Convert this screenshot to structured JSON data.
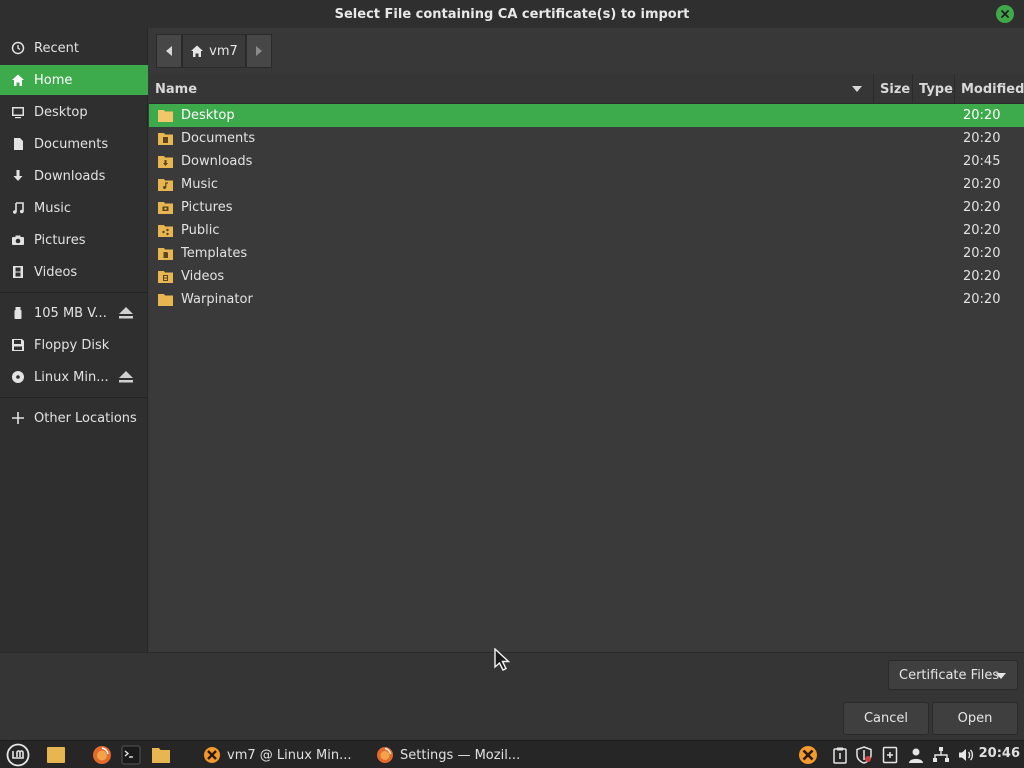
{
  "window": {
    "title": "Select File containing CA certificate(s) to import"
  },
  "sidebar": {
    "items": [
      {
        "label": "Recent",
        "icon": "clock-icon"
      },
      {
        "label": "Home",
        "icon": "home-icon",
        "active": true
      },
      {
        "label": "Desktop",
        "icon": "desktop-icon"
      },
      {
        "label": "Documents",
        "icon": "document-icon"
      },
      {
        "label": "Downloads",
        "icon": "download-icon"
      },
      {
        "label": "Music",
        "icon": "music-icon"
      },
      {
        "label": "Pictures",
        "icon": "camera-icon"
      },
      {
        "label": "Videos",
        "icon": "film-icon"
      }
    ],
    "devices": [
      {
        "label": "105 MB V...",
        "icon": "usb-drive-icon",
        "ejectable": true
      },
      {
        "label": "Floppy Disk",
        "icon": "floppy-icon",
        "ejectable": false
      },
      {
        "label": "Linux Min...",
        "icon": "optical-disc-icon",
        "ejectable": true
      }
    ],
    "other": {
      "label": "Other Locations",
      "icon": "plus-icon"
    }
  },
  "pathbar": {
    "current": "vm7"
  },
  "filelist": {
    "columns": {
      "name": "Name",
      "size": "Size",
      "type": "Type",
      "modified": "Modified"
    },
    "rows": [
      {
        "name": "Desktop",
        "modified": "20:20",
        "icon": "folder-icon",
        "selected": true
      },
      {
        "name": "Documents",
        "modified": "20:20",
        "icon": "folder-documents-icon"
      },
      {
        "name": "Downloads",
        "modified": "20:45",
        "icon": "folder-download-icon"
      },
      {
        "name": "Music",
        "modified": "20:20",
        "icon": "folder-music-icon"
      },
      {
        "name": "Pictures",
        "modified": "20:20",
        "icon": "folder-pictures-icon"
      },
      {
        "name": "Public",
        "modified": "20:20",
        "icon": "folder-public-icon"
      },
      {
        "name": "Templates",
        "modified": "20:20",
        "icon": "folder-templates-icon"
      },
      {
        "name": "Videos",
        "modified": "20:20",
        "icon": "folder-videos-icon"
      },
      {
        "name": "Warpinator",
        "modified": "20:20",
        "icon": "folder-icon"
      }
    ]
  },
  "footer": {
    "filter": "Certificate Files",
    "cancel": "Cancel",
    "open": "Open"
  },
  "taskbar": {
    "windows": [
      {
        "label": "vm7 @ Linux Min...",
        "icon": "xserver-icon"
      },
      {
        "label": "Settings — Mozil...",
        "icon": "firefox-icon"
      }
    ],
    "clock": "20:46"
  },
  "colors": {
    "accent": "#3daa4c",
    "folder": "#e8b650"
  }
}
